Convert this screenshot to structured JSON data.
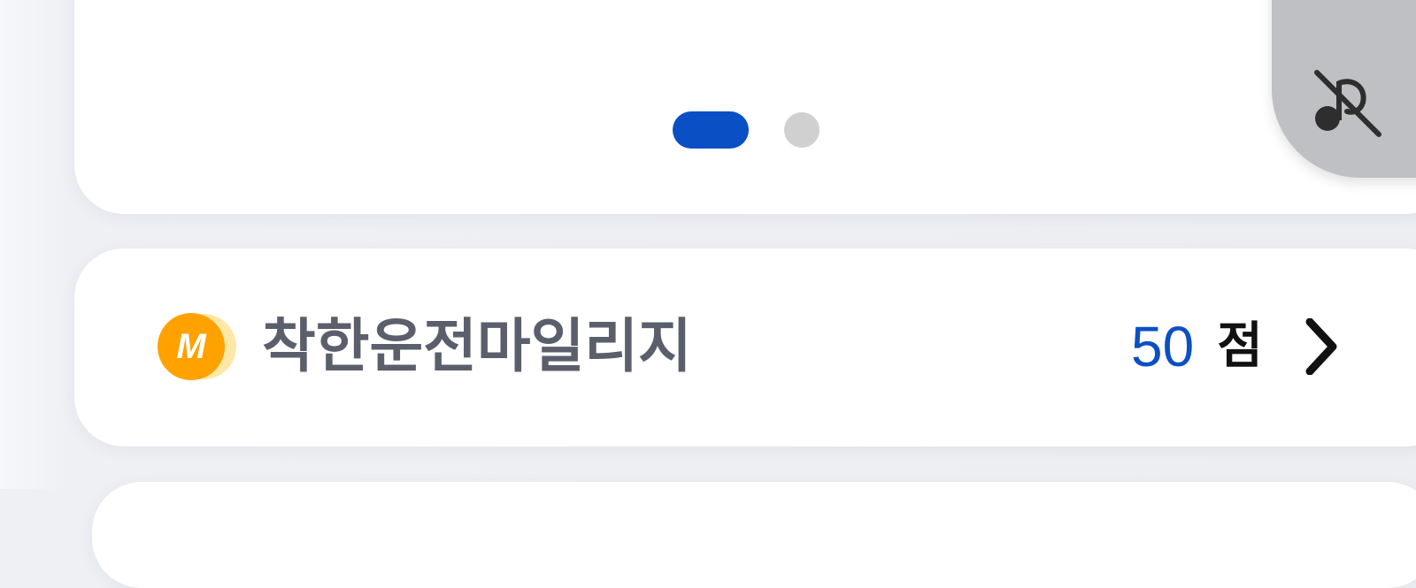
{
  "colors": {
    "accent_blue": "#0b4fc5",
    "pager_inactive": "#d0d0d0",
    "title_gray": "#5a5f6b",
    "badge_orange": "#ffa200",
    "toggle_gray": "#bfc0c3"
  },
  "banner": {
    "page_indicator": {
      "total": 2,
      "active_index": 0
    },
    "sound_toggle_icon": "music-note-off-icon"
  },
  "mileage": {
    "badge_letter": "M",
    "title": "착한운전마일리지",
    "points_value": "50",
    "points_unit": "점",
    "chevron_icon": "chevron-right-icon"
  }
}
